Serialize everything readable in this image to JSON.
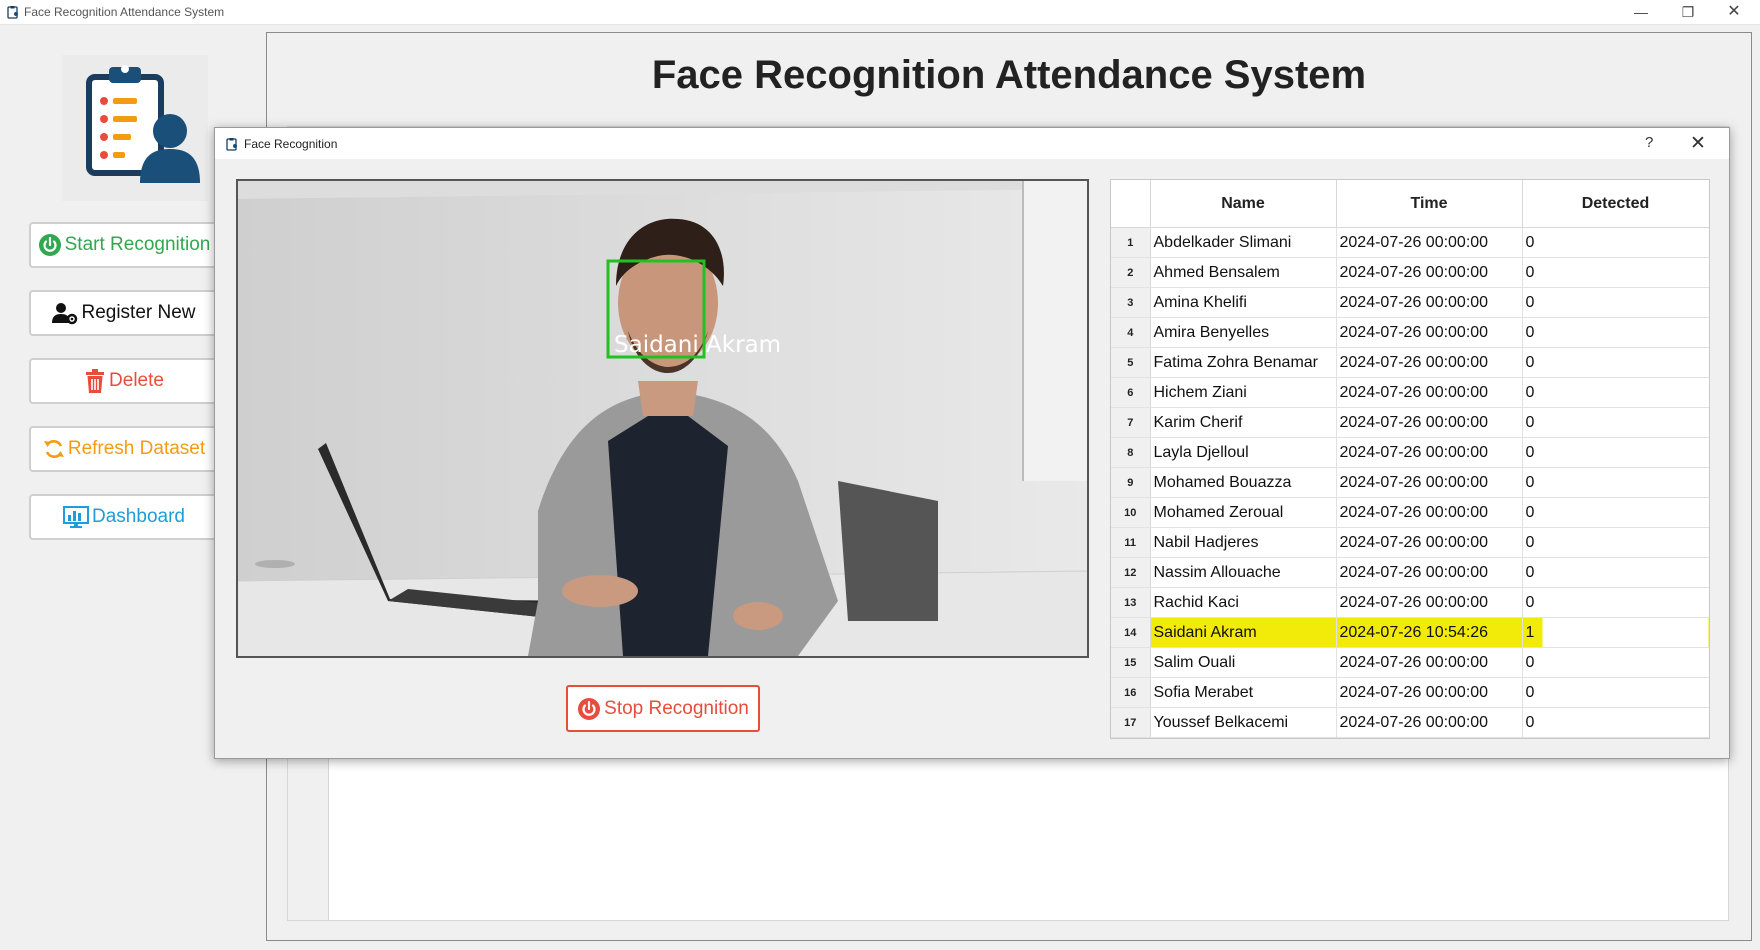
{
  "window": {
    "title": "Face Recognition Attendance System",
    "controls": {
      "minimize": "—",
      "maximize": "❐",
      "close": "✕"
    }
  },
  "sidebar": {
    "logo_icon": "clipboard-person-icon",
    "buttons": {
      "start": {
        "label": "Start Recognition",
        "icon": "power-icon",
        "color": "#2fa84f"
      },
      "register": {
        "label": "Register New",
        "icon": "user-gear-icon",
        "color": "#111111"
      },
      "delete": {
        "label": "Delete",
        "icon": "trash-icon",
        "color": "#e74c3c"
      },
      "refresh": {
        "label": "Refresh Dataset",
        "icon": "refresh-icon",
        "color": "#f39c12"
      },
      "dashboard": {
        "label": "Dashboard",
        "icon": "dashboard-icon",
        "color": "#1e9ed8"
      }
    }
  },
  "main": {
    "title": "Face Recognition Attendance System"
  },
  "dialog": {
    "title": "Face Recognition",
    "help": "?",
    "close": "✕",
    "camera": {
      "detected_label": "Saidani Akram",
      "box_color": "#22c022"
    },
    "stop_button": {
      "label": "Stop Recognition",
      "icon": "power-icon",
      "color": "#e74c3c"
    },
    "table": {
      "columns": [
        "Name",
        "Time",
        "Detected"
      ],
      "highlight_color": "#f2ea08",
      "rows": [
        {
          "n": "1",
          "name": "Abdelkader Slimani",
          "time": "2024-07-26 00:00:00",
          "detected": "0"
        },
        {
          "n": "2",
          "name": "Ahmed Bensalem",
          "time": "2024-07-26 00:00:00",
          "detected": "0"
        },
        {
          "n": "3",
          "name": "Amina Khelifi",
          "time": "2024-07-26 00:00:00",
          "detected": "0"
        },
        {
          "n": "4",
          "name": "Amira Benyelles",
          "time": "2024-07-26 00:00:00",
          "detected": "0"
        },
        {
          "n": "5",
          "name": "Fatima Zohra Benamar",
          "time": "2024-07-26 00:00:00",
          "detected": "0"
        },
        {
          "n": "6",
          "name": "Hichem Ziani",
          "time": "2024-07-26 00:00:00",
          "detected": "0"
        },
        {
          "n": "7",
          "name": "Karim Cherif",
          "time": "2024-07-26 00:00:00",
          "detected": "0"
        },
        {
          "n": "8",
          "name": "Layla Djelloul",
          "time": "2024-07-26 00:00:00",
          "detected": "0"
        },
        {
          "n": "9",
          "name": "Mohamed Bouazza",
          "time": "2024-07-26 00:00:00",
          "detected": "0"
        },
        {
          "n": "10",
          "name": "Mohamed Zeroual",
          "time": "2024-07-26 00:00:00",
          "detected": "0"
        },
        {
          "n": "11",
          "name": "Nabil Hadjeres",
          "time": "2024-07-26 00:00:00",
          "detected": "0"
        },
        {
          "n": "12",
          "name": "Nassim Allouache",
          "time": "2024-07-26 00:00:00",
          "detected": "0"
        },
        {
          "n": "13",
          "name": "Rachid Kaci",
          "time": "2024-07-26 00:00:00",
          "detected": "0"
        },
        {
          "n": "14",
          "name": "Saidani Akram",
          "time": "2024-07-26 10:54:26",
          "detected": "1",
          "highlighted": true
        },
        {
          "n": "15",
          "name": "Salim Ouali",
          "time": "2024-07-26 00:00:00",
          "detected": "0"
        },
        {
          "n": "16",
          "name": "Sofia Merabet",
          "time": "2024-07-26 00:00:00",
          "detected": "0"
        },
        {
          "n": "17",
          "name": "Youssef Belkacemi",
          "time": "2024-07-26 00:00:00",
          "detected": "0"
        }
      ]
    }
  }
}
